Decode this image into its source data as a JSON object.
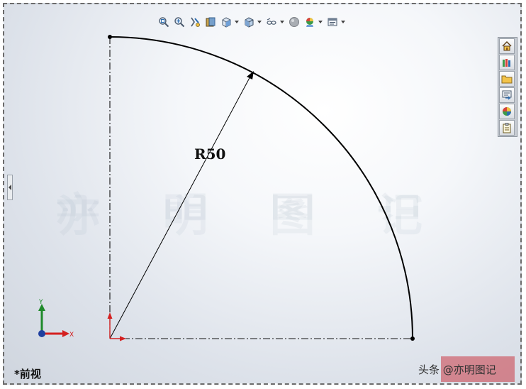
{
  "toolbar": {
    "buttons": [
      {
        "icon": "zoom-to-fit-icon"
      },
      {
        "icon": "zoom-to-area-icon"
      },
      {
        "icon": "previous-view-icon"
      },
      {
        "icon": "section-view-icon"
      },
      {
        "icon": "view-orientation-icon",
        "dropdown": true
      },
      {
        "icon": "display-style-icon",
        "dropdown": true
      },
      {
        "icon": "hide-show-items-icon",
        "dropdown": true
      },
      {
        "icon": "edit-appearance-icon"
      },
      {
        "icon": "apply-scene-icon",
        "dropdown": true
      },
      {
        "icon": "view-settings-icon",
        "dropdown": true
      }
    ]
  },
  "task_pane": {
    "buttons": [
      {
        "icon": "resources-home-icon"
      },
      {
        "icon": "design-library-icon"
      },
      {
        "icon": "file-explorer-icon"
      },
      {
        "icon": "view-palette-icon"
      },
      {
        "icon": "appearances-scenes-icon"
      },
      {
        "icon": "custom-properties-icon"
      }
    ]
  },
  "sketch": {
    "dimension_label": "R50",
    "radius": 50,
    "arc_degrees": 90
  },
  "triad": {
    "x_label": "X",
    "y_label": "Y"
  },
  "watermark": {
    "chars": [
      "亦",
      "明",
      "图",
      "记"
    ]
  },
  "view": {
    "name": "*前视"
  },
  "credit": {
    "text": "头条 @亦明图记"
  },
  "colors": {
    "sketch_line": "#000000",
    "axis_x": "#d42020",
    "axis_y": "#1f8a2b",
    "origin_arrow": "#d42020"
  }
}
